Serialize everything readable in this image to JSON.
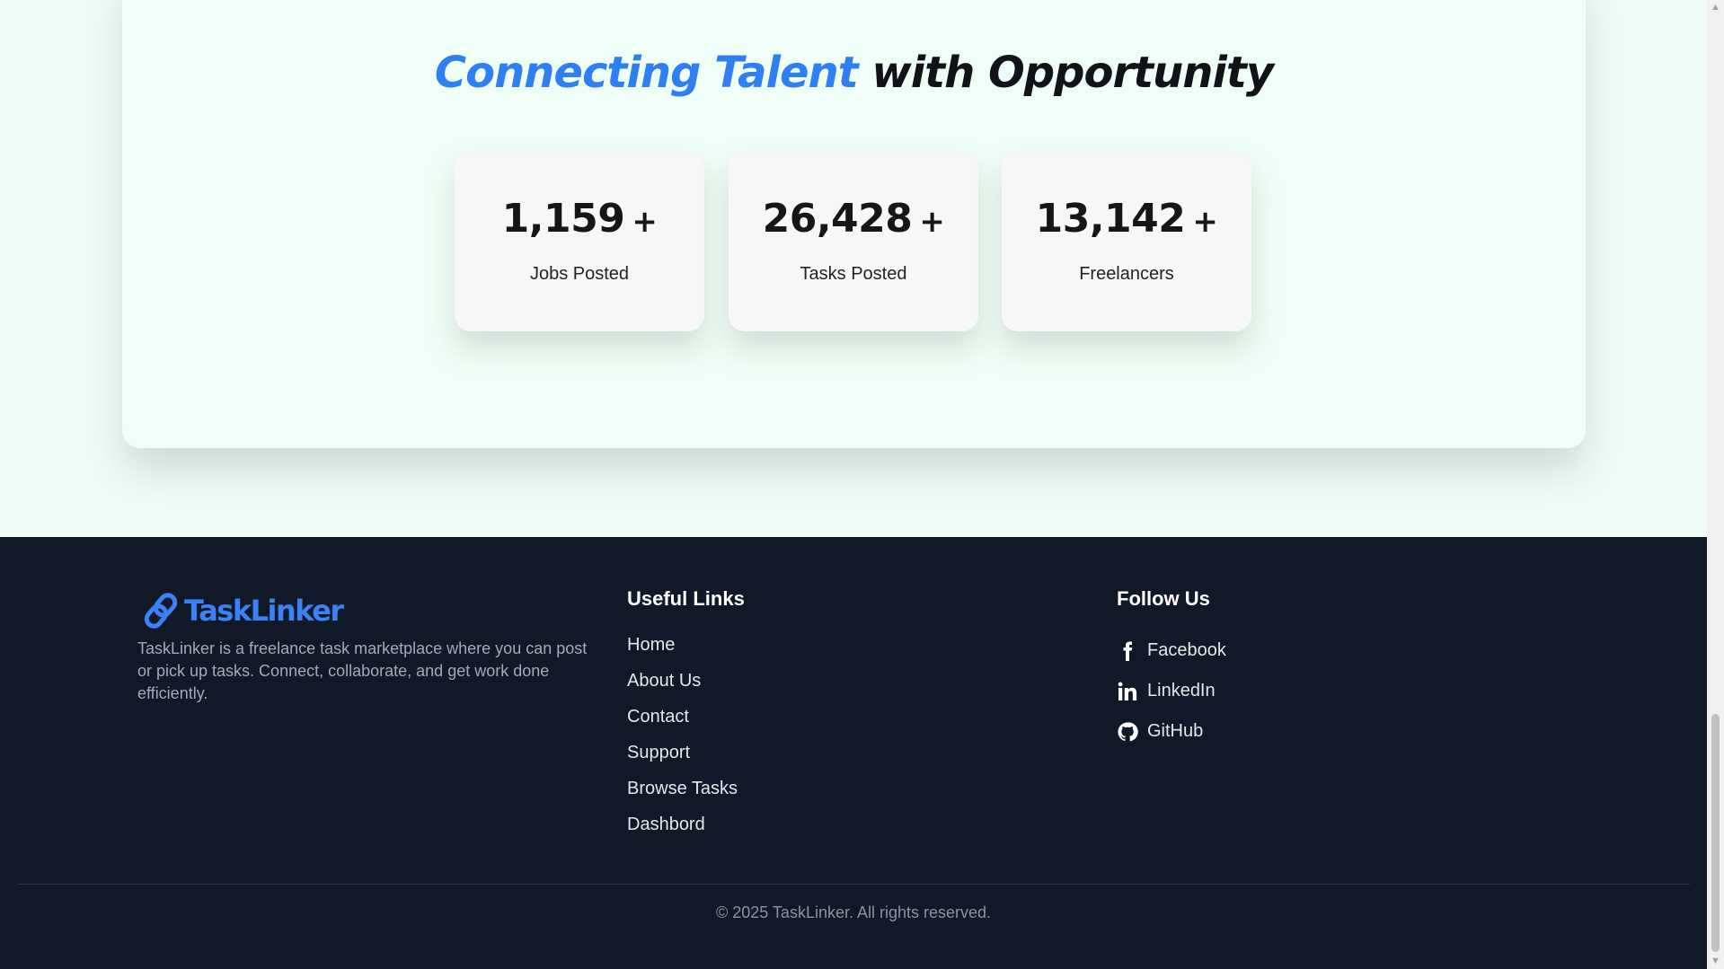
{
  "hero": {
    "headline_accent": "Connecting Talent",
    "headline_rest": " with Opportunity"
  },
  "stats": [
    {
      "number": "1,159",
      "suffix": "+",
      "label": "Jobs Posted"
    },
    {
      "number": "26,428",
      "suffix": "+",
      "label": "Tasks Posted"
    },
    {
      "number": "13,142",
      "suffix": "+",
      "label": "Freelancers"
    }
  ],
  "footer": {
    "brand": "TaskLinker",
    "brand_icon": "link-icon",
    "description": "TaskLinker is a freelance task marketplace where you can post or pick up tasks. Connect, collaborate, and get work done efficiently.",
    "useful_links_title": "Useful Links",
    "useful_links": [
      "Home",
      "About Us",
      "Contact",
      "Support",
      "Browse Tasks",
      "Dashbord"
    ],
    "follow_title": "Follow Us",
    "social": [
      {
        "label": "Facebook",
        "icon": "facebook-icon"
      },
      {
        "label": "LinkedIn",
        "icon": "linkedin-icon"
      },
      {
        "label": "GitHub",
        "icon": "github-icon"
      }
    ],
    "copyright": "© 2025 TaskLinker. All rights reserved."
  },
  "colors": {
    "accent": "#2f7ef2",
    "footer_bg": "#111827",
    "section_bg": "#f0fdf7"
  }
}
